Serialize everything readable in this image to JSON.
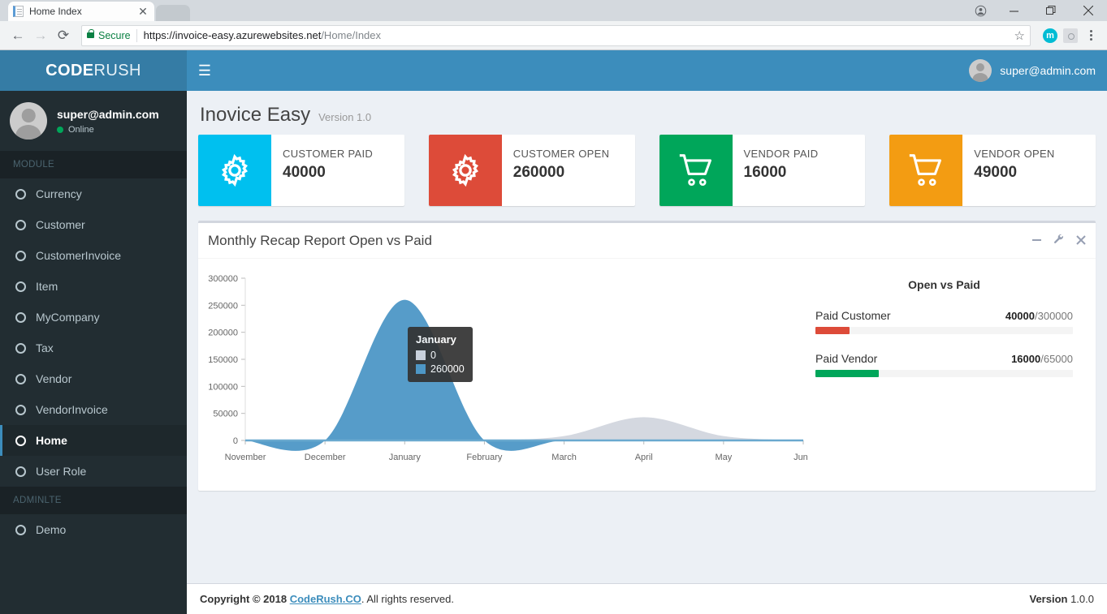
{
  "browser": {
    "tab_title": "Home Index",
    "tab_close_icon": "close-icon",
    "back_icon": "back-arrow-icon",
    "forward_icon": "forward-arrow-icon",
    "reload_icon": "reload-icon",
    "lock_icon": "lock-icon",
    "secure_label": "Secure",
    "url_domain": "https://invoice-easy.azurewebsites.net",
    "url_path": "/Home/Index",
    "star_icon": "bookmark-star-icon",
    "extension_avatar": "m",
    "extension_icon": "extension-icon",
    "menu_icon": "kebab-menu-icon",
    "profile_icon": "browser-profile-icon",
    "minimize_icon": "minimize-icon",
    "maximize_icon": "restore-icon",
    "close_icon": "window-close-icon",
    "minimize_glyph": "—",
    "maximize_glyph": "❐",
    "close_glyph": "✕"
  },
  "topbar": {
    "logo_bold": "CODE",
    "logo_light": "RUSH",
    "hamburger_glyph": "☰",
    "user_email": "super@admin.com"
  },
  "sidebar": {
    "user": {
      "email": "super@admin.com",
      "status": "Online"
    },
    "sections": [
      {
        "header": "MODULE",
        "items": [
          {
            "label": "Currency",
            "active": false
          },
          {
            "label": "Customer",
            "active": false
          },
          {
            "label": "CustomerInvoice",
            "active": false
          },
          {
            "label": "Item",
            "active": false
          },
          {
            "label": "MyCompany",
            "active": false
          },
          {
            "label": "Tax",
            "active": false
          },
          {
            "label": "Vendor",
            "active": false
          },
          {
            "label": "VendorInvoice",
            "active": false
          },
          {
            "label": "Home",
            "active": true
          },
          {
            "label": "User Role",
            "active": false
          }
        ]
      },
      {
        "header": "ADMINLTE",
        "items": [
          {
            "label": "Demo",
            "active": false
          }
        ]
      }
    ]
  },
  "page": {
    "title": "Inovice Easy",
    "version": "Version 1.0"
  },
  "info_boxes": [
    {
      "label": "CUSTOMER PAID",
      "value": "40000",
      "color": "#00c0ef",
      "icon": "gear-icon"
    },
    {
      "label": "CUSTOMER OPEN",
      "value": "260000",
      "color": "#dd4b39",
      "icon": "gear-icon"
    },
    {
      "label": "VENDOR PAID",
      "value": "16000",
      "color": "#00a65a",
      "icon": "cart-icon"
    },
    {
      "label": "VENDOR OPEN",
      "value": "49000",
      "color": "#f39c12",
      "icon": "cart-icon"
    }
  ],
  "panel": {
    "title": "Monthly Recap Report Open vs Paid",
    "tools": [
      {
        "name": "minimize-panel",
        "glyph": "−"
      },
      {
        "name": "wrench-panel",
        "glyph": "🔧"
      },
      {
        "name": "close-panel",
        "glyph": "✕"
      }
    ]
  },
  "tooltip": {
    "title": "January",
    "rows": [
      {
        "color": "#d2d6de",
        "value": "0"
      },
      {
        "color": "#4d97c6",
        "value": "260000"
      }
    ]
  },
  "open_vs_paid": {
    "title": "Open vs Paid",
    "items": [
      {
        "name": "Paid Customer",
        "current": "40000",
        "total": "/300000",
        "percent": 13.3,
        "color": "#dd4b39"
      },
      {
        "name": "Paid Vendor",
        "current": "16000",
        "total": "/65000",
        "percent": 24.6,
        "color": "#00a65a"
      }
    ]
  },
  "footer": {
    "copyright_prefix": "Copyright © 2018 ",
    "brand": "CodeRush.CO",
    "copyright_suffix": ". All rights reserved.",
    "version_label": "Version",
    "version_value": "1.0.0"
  },
  "chart_data": {
    "type": "area",
    "title": "Monthly Recap Report Open vs Paid",
    "categories": [
      "November",
      "December",
      "January",
      "February",
      "March",
      "April",
      "May",
      "June"
    ],
    "series": [
      {
        "name": "Paid",
        "color": "#d2d6de",
        "values": [
          0,
          0,
          0,
          0,
          8000,
          43000,
          8000,
          0
        ]
      },
      {
        "name": "Open",
        "color": "#4d97c6",
        "values": [
          0,
          0,
          260000,
          0,
          0,
          0,
          0,
          0
        ]
      }
    ],
    "xlabel": "",
    "ylabel": "",
    "ylim": [
      0,
      300000
    ],
    "yticks": [
      "0",
      "50000",
      "100000",
      "150000",
      "200000",
      "250000",
      "300000"
    ],
    "grid": false,
    "legend": "none"
  }
}
